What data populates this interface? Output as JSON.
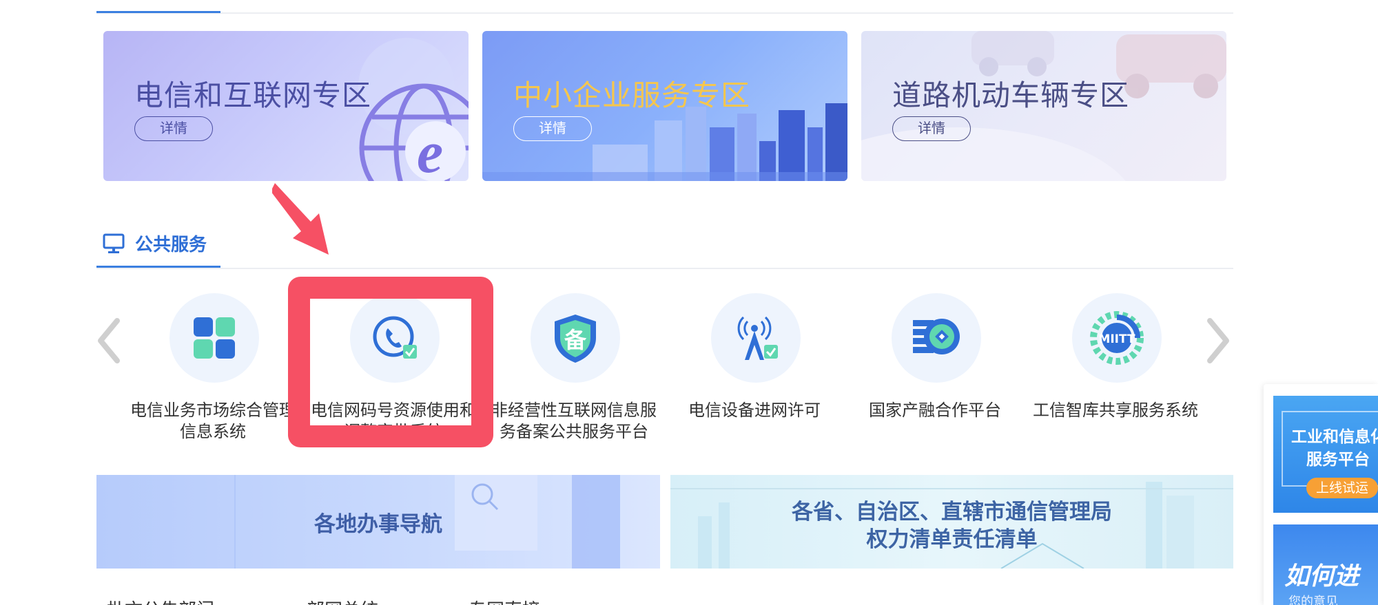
{
  "zones": [
    {
      "title": "电信和互联网专区",
      "button": "详情"
    },
    {
      "title": "中小企业服务专区",
      "button": "详情"
    },
    {
      "title": "道路机动车辆专区",
      "button": "详情"
    }
  ],
  "section": {
    "title": "公共服务",
    "icon": "monitor-icon",
    "accent_color": "#2f6fd6"
  },
  "highlight_color": "#f65064",
  "services": [
    {
      "label": "电信业务市场综合管理信息系统",
      "icon": "apps-grid-icon"
    },
    {
      "label": "电信网码号资源使用和调整审批系统",
      "icon": "phone-check-icon"
    },
    {
      "label": "非经营性互联网信息服务备案公共服务平台",
      "icon": "shield-bei-icon"
    },
    {
      "label": "电信设备进网许可",
      "icon": "signal-tower-icon"
    },
    {
      "label": "国家产融合作平台",
      "icon": "coin-stack-icon"
    },
    {
      "label": "工信智库共享服务系统",
      "icon": "gear-miitt-icon"
    }
  ],
  "banners": {
    "nav": "各地办事导航",
    "list_line1": "各省、自治区、直辖市通信管理局",
    "list_line2": "权力清单责任清单"
  },
  "bottom_tabs": [
    "批文公告部门",
    "部网总统",
    "专网直接"
  ],
  "side": {
    "promo_line1": "工业和信息化",
    "promo_line2": "服务平台",
    "promo_badge": "上线试运",
    "howto_title": "如何进",
    "howto_sub": "您的意见"
  }
}
